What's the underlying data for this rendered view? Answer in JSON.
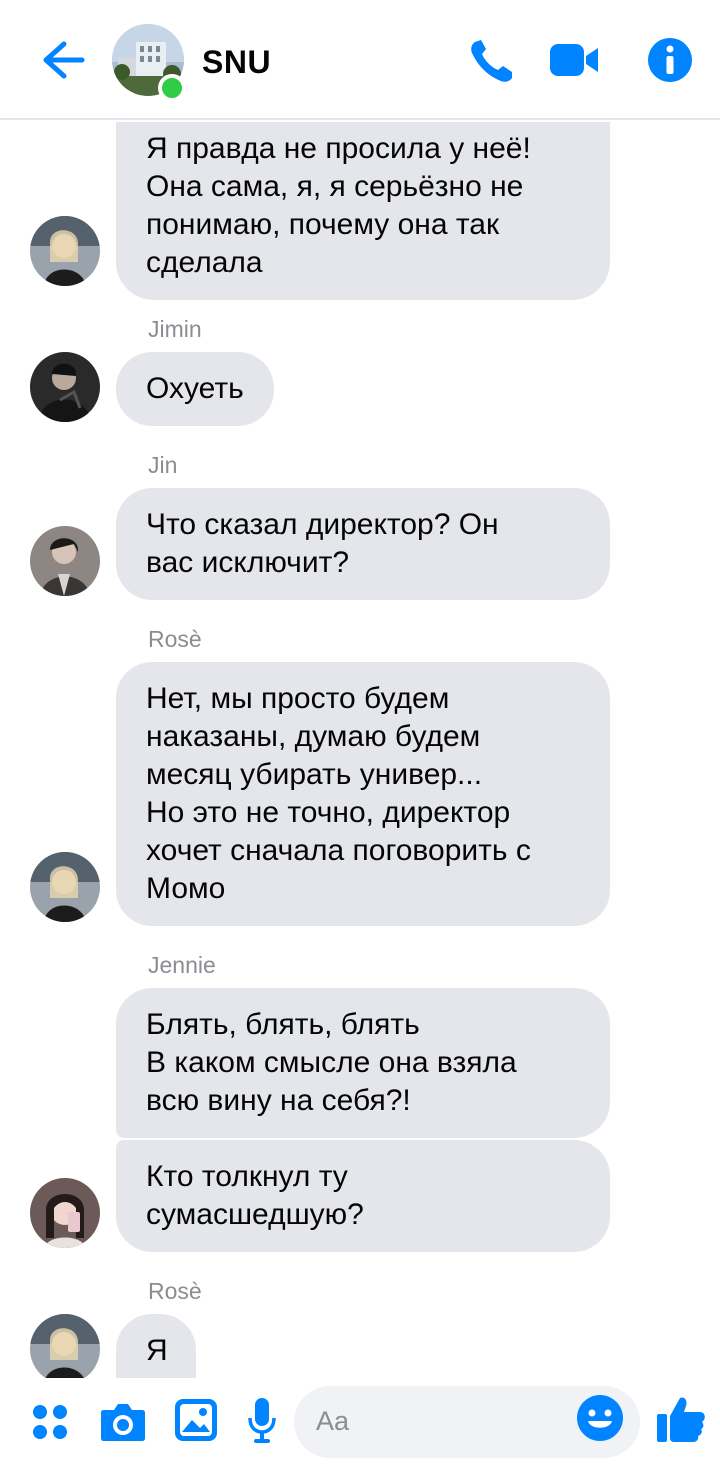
{
  "header": {
    "title": "SNU",
    "accent": "#0084ff",
    "online": "#31cc46"
  },
  "messages": [
    {
      "sender": "",
      "lines": "Я правда не просила у неё!\nОна сама, я, я серьёзно не\nпонимаю, почему она так\nсделала"
    },
    {
      "sender": "Jimin",
      "lines": "Охуеть"
    },
    {
      "sender": "Jin",
      "lines": "Что сказал директор? Он\nвас исключит?"
    },
    {
      "sender": "Rosè",
      "lines": "Нет, мы просто будем\nнаказаны, думаю будем\nмесяц убирать универ...\nНо это не точно, директор\nхочет сначала поговорить с\nМомо"
    },
    {
      "sender": "Jennie",
      "lines": "Блять, блять, блять\nВ каком смысле она взяла\nвсю вину на себя?!"
    },
    {
      "sender": "",
      "lines": "Кто толкнул ту\nсумасшедшую?"
    },
    {
      "sender": "Rosè",
      "lines": "Я"
    }
  ],
  "composer": {
    "placeholder": "Aa"
  },
  "icons": [
    "back-arrow-icon",
    "phone-icon",
    "video-camera-icon",
    "info-icon",
    "apps-icon",
    "camera-icon",
    "image-icon",
    "microphone-icon",
    "emoji-icon",
    "thumbs-up-icon"
  ]
}
